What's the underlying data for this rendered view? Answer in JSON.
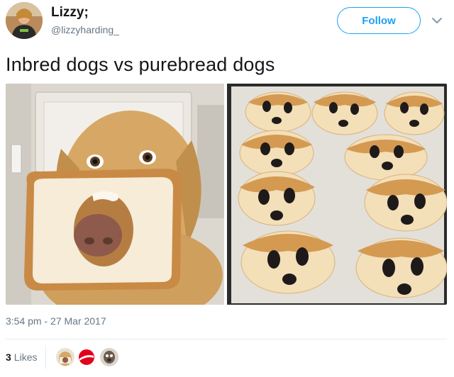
{
  "author": {
    "display_name": "Lizzy;",
    "handle": "@lizzyharding_"
  },
  "follow_label": "Follow",
  "tweet_text": "Inbred dogs vs purebread dogs",
  "timestamp": "3:54 pm - 27 Mar 2017",
  "likes": {
    "count": "3",
    "label": "Likes"
  },
  "colors": {
    "accent": "#1da1f2",
    "muted": "#657786"
  }
}
